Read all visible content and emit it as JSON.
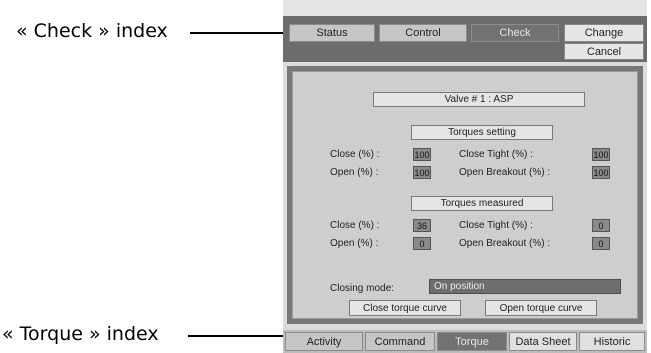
{
  "annotations": {
    "check_index": "« Check » index",
    "torque_index": "« Torque » index"
  },
  "top_tabs": [
    {
      "label": "Status",
      "active": false
    },
    {
      "label": "Control",
      "active": false
    },
    {
      "label": "Check",
      "active": true
    }
  ],
  "side_buttons": {
    "change": "Change",
    "cancel": "Cancel"
  },
  "valve": {
    "title": "Valve #  1   : ASP"
  },
  "torques_setting": {
    "header": "Torques setting",
    "close_label": "Close (%) :",
    "close_value": "100",
    "close_tight_label": "Close Tight (%) :",
    "close_tight_value": "100",
    "open_label": "Open (%) :",
    "open_value": "100",
    "open_breakout_label": "Open Breakout (%) :",
    "open_breakout_value": "100"
  },
  "torques_measured": {
    "header": "Torques measured",
    "close_label": "Close (%) :",
    "close_value": "36",
    "close_tight_label": "Close Tight (%) :",
    "close_tight_value": "0",
    "open_label": "Open (%) :",
    "open_value": "0",
    "open_breakout_label": "Open Breakout (%) :",
    "open_breakout_value": "0"
  },
  "closing_mode": {
    "label": "Closing mode:",
    "value": "On position"
  },
  "curve_buttons": {
    "close": "Close torque curve",
    "open": "Open torque curve"
  },
  "bottom_tabs": [
    {
      "label": "Activity",
      "active": false
    },
    {
      "label": "Command",
      "active": false
    },
    {
      "label": "Torque",
      "active": true
    },
    {
      "label": "Data Sheet",
      "active": false
    },
    {
      "label": "Historic",
      "active": false
    }
  ]
}
